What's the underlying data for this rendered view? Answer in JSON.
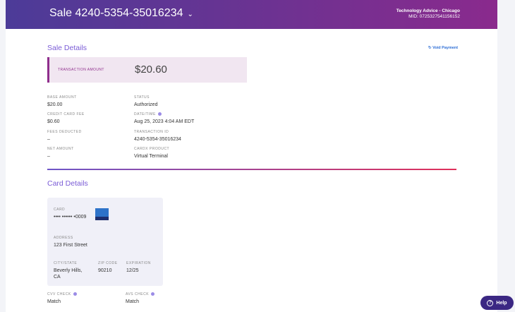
{
  "header": {
    "title": "Sale 4240-5354-35016234",
    "merchant": "Technology Advice - Chicago",
    "mid": "MID: 0725327541156152"
  },
  "sale": {
    "title": "Sale Details",
    "void_label": "Void Payment",
    "tx_label": "TRANSACTION AMOUNT",
    "tx_amount": "$20.60",
    "fields": [
      {
        "label": "BASE AMOUNT",
        "value": "$20.00"
      },
      {
        "label": "STATUS",
        "value": "Authorized"
      },
      {
        "label": "CREDIT CARD FEE",
        "value": "$0.60"
      },
      {
        "label": "DATE/TIME",
        "value": "Aug 25, 2023 4:04 AM EDT"
      },
      {
        "label": "FEES DEDUCTED",
        "value": "–"
      },
      {
        "label": "TRANSACTION ID",
        "value": "4240-5354-35016234"
      },
      {
        "label": "NET AMOUNT",
        "value": "–"
      },
      {
        "label": "CARDX PRODUCT",
        "value": "Virtual Terminal"
      }
    ]
  },
  "card": {
    "title": "Card Details",
    "card_label": "CARD",
    "card_value": "•••• •••••• •0009",
    "brand": "American Express",
    "address_label": "ADDRESS",
    "address": "123 First Street",
    "city_label": "CITY/STATE",
    "city": "Beverly Hills, CA",
    "zip_label": "ZIP CODE",
    "zip": "90210",
    "exp_label": "EXPIRATION",
    "exp": "12/25",
    "cvv_label": "CVV CHECK",
    "cvv": "Match",
    "avs_label": "AVS CHECK",
    "avs": "Match"
  },
  "help": {
    "label": "Help"
  }
}
